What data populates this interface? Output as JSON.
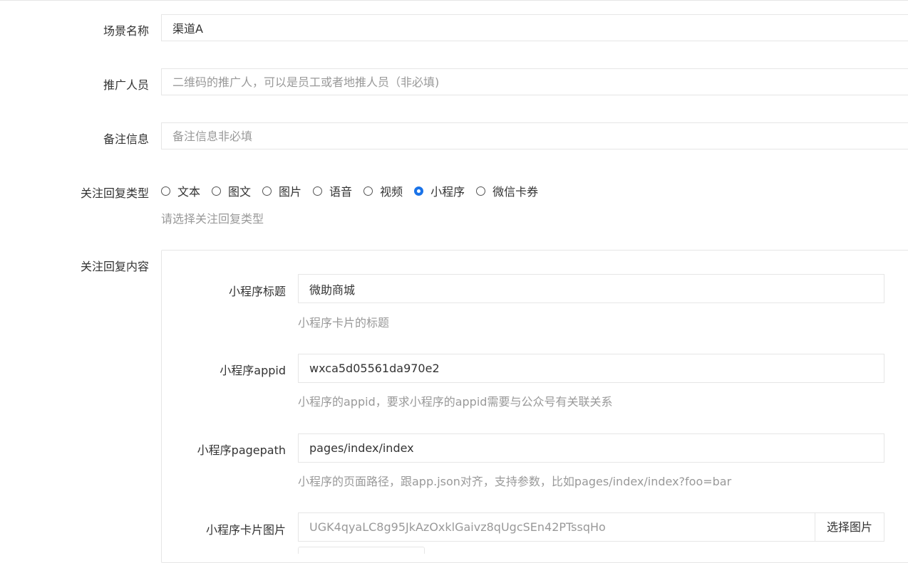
{
  "form": {
    "scene_name": {
      "label": "场景名称",
      "value": "渠道A"
    },
    "promoter": {
      "label": "推广人员",
      "value": "",
      "placeholder": "二维码的推广人，可以是员工或者地推人员（非必填)"
    },
    "remark": {
      "label": "备注信息",
      "value": "",
      "placeholder": "备注信息非必填"
    },
    "reply_type": {
      "label": "关注回复类型",
      "options": [
        "文本",
        "图文",
        "图片",
        "语音",
        "视频",
        "小程序",
        "微信卡券"
      ],
      "selected": "小程序",
      "hint": "请选择关注回复类型"
    },
    "reply_content": {
      "label": "关注回复内容",
      "mini_title": {
        "label": "小程序标题",
        "value": "微助商城",
        "hint": "小程序卡片的标题"
      },
      "mini_appid": {
        "label": "小程序appid",
        "value": "wxca5d05561da970e2",
        "hint": "小程序的appid，要求小程序的appid需要与公众号有关联关系"
      },
      "mini_pagepath": {
        "label": "小程序pagepath",
        "value": "pages/index/index",
        "hint": "小程序的页面路径，跟app.json对齐，支持参数，比如pages/index/index?foo=bar"
      },
      "mini_card_image": {
        "label": "小程序卡片图片",
        "value": "UGK4qyaLC8g95JkAzOxklGaivz8qUgcSEn42PTssqHo",
        "button": "选择图片"
      }
    }
  },
  "colors": {
    "accent": "#1a73e8",
    "border": "#e6e6e6",
    "hint": "#999999",
    "text": "#333333"
  }
}
